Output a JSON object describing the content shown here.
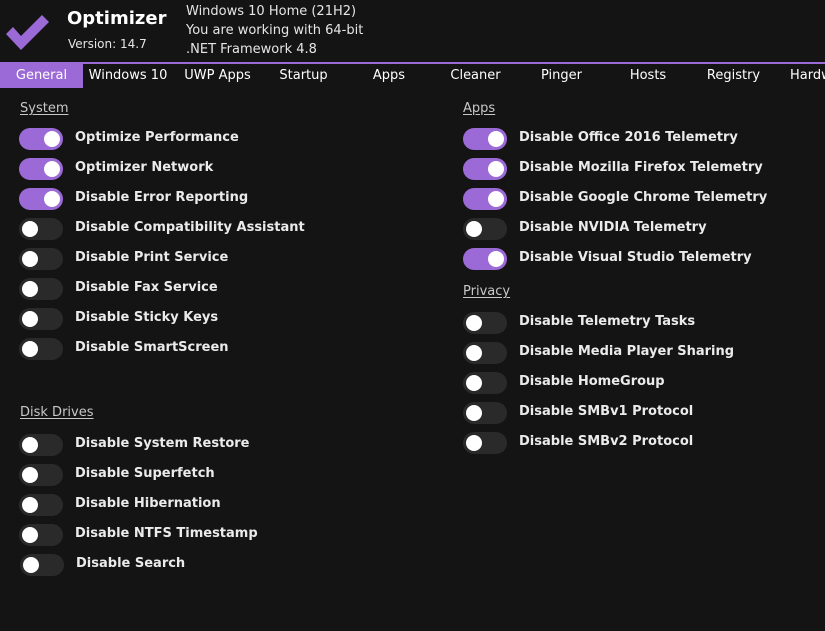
{
  "app": {
    "name": "Optimizer",
    "version": "Version: 14.7",
    "logo_icon": "checkmark-icon"
  },
  "system_info": [
    "Windows 10 Home (21H2)",
    "You are working with 64-bit",
    ".NET Framework 4.8"
  ],
  "tabs": [
    {
      "label": "General",
      "active": true
    },
    {
      "label": "Windows 10",
      "active": false
    },
    {
      "label": "UWP Apps",
      "active": false
    },
    {
      "label": "Startup",
      "active": false
    },
    {
      "label": "Apps",
      "active": false
    },
    {
      "label": "Cleaner",
      "active": false
    },
    {
      "label": "Pinger",
      "active": false
    },
    {
      "label": "Hosts",
      "active": false
    },
    {
      "label": "Registry",
      "active": false
    },
    {
      "label": "Hardw",
      "active": false
    }
  ],
  "sections": {
    "system": {
      "title": "System",
      "options": [
        {
          "label": "Optimize Performance",
          "on": true
        },
        {
          "label": "Optimizer Network",
          "on": true
        },
        {
          "label": "Disable Error Reporting",
          "on": true
        },
        {
          "label": "Disable Compatibility Assistant",
          "on": false
        },
        {
          "label": "Disable Print Service",
          "on": false
        },
        {
          "label": "Disable Fax Service",
          "on": false
        },
        {
          "label": "Disable Sticky Keys",
          "on": false
        },
        {
          "label": "Disable SmartScreen",
          "on": false
        }
      ]
    },
    "disk_drives": {
      "title": "Disk Drives",
      "options": [
        {
          "label": "Disable System Restore",
          "on": false
        },
        {
          "label": "Disable Superfetch",
          "on": false
        },
        {
          "label": "Disable Hibernation",
          "on": false
        },
        {
          "label": "Disable NTFS Timestamp",
          "on": false
        },
        {
          "label": "Disable Search",
          "on": false
        }
      ]
    },
    "apps": {
      "title": "Apps",
      "options": [
        {
          "label": "Disable Office 2016 Telemetry",
          "on": true
        },
        {
          "label": "Disable Mozilla Firefox Telemetry",
          "on": true
        },
        {
          "label": "Disable Google Chrome Telemetry",
          "on": true
        },
        {
          "label": "Disable NVIDIA Telemetry",
          "on": false
        },
        {
          "label": "Disable Visual Studio Telemetry",
          "on": true
        }
      ]
    },
    "privacy": {
      "title": "Privacy",
      "options": [
        {
          "label": "Disable Telemetry Tasks",
          "on": false
        },
        {
          "label": "Disable Media Player Sharing",
          "on": false
        },
        {
          "label": "Disable HomeGroup",
          "on": false
        },
        {
          "label": "Disable SMBv1 Protocol",
          "on": false
        },
        {
          "label": "Disable SMBv2 Protocol",
          "on": false
        }
      ]
    }
  },
  "colors": {
    "accent": "#9b6ad6",
    "background": "#141414",
    "toggle_off": "#2a2a2a",
    "text": "#ebebeb"
  }
}
